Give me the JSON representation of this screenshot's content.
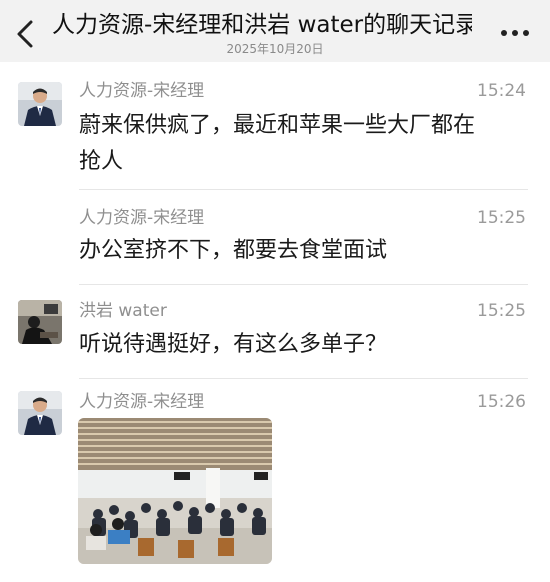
{
  "header": {
    "title": "人力资源-宋经理和洪岩 water的聊天记录",
    "date": "2025年10月20日",
    "back_icon": "chevron-left-icon",
    "more_icon": "ellipsis-icon"
  },
  "messages": [
    {
      "sender": "人力资源-宋经理",
      "time": "15:24",
      "text_lines": [
        "蔚来保供疯了，最近和苹果一些大厂都在",
        "抢人"
      ]
    },
    {
      "sender": "人力资源-宋经理",
      "time": "15:25",
      "text_lines": [
        "办公室挤不下，都要去食堂面试"
      ]
    },
    {
      "sender": "洪岩 water",
      "time": "15:25",
      "text_lines": [
        "听说待遇挺好，有这么多单子？"
      ]
    },
    {
      "sender": "人力资源-宋经理",
      "time": "15:26",
      "image": "cafeteria-photo"
    }
  ]
}
